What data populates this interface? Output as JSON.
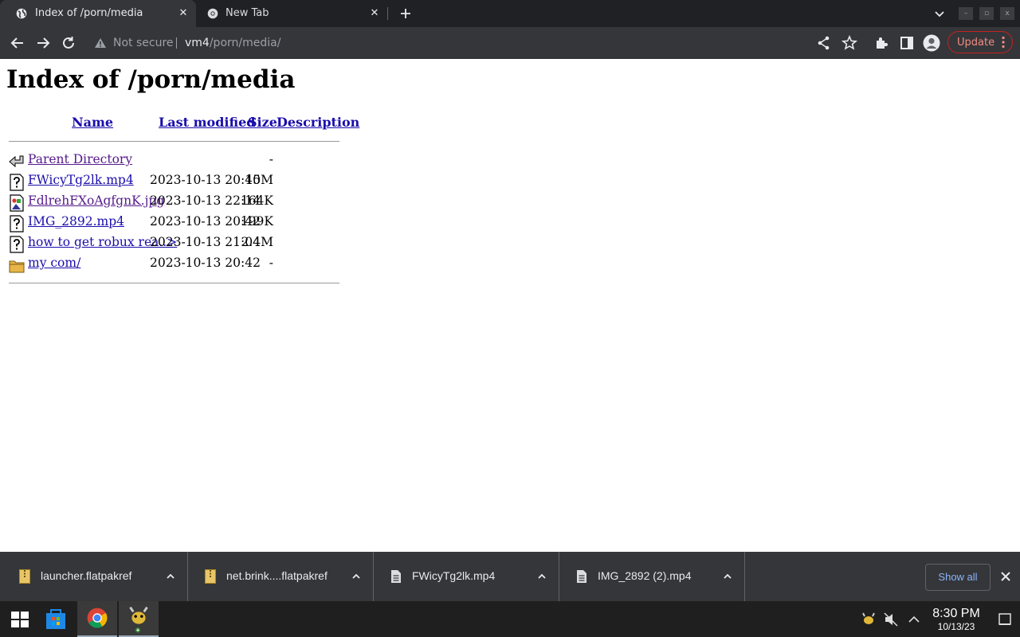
{
  "browser": {
    "tabs": [
      {
        "title": "Index of /porn/media",
        "active": true
      },
      {
        "title": "New Tab",
        "active": false
      }
    ],
    "omnibox": {
      "security_label": "Not secure",
      "host": "vm4",
      "path": "/porn/media/"
    },
    "update_label": "Update"
  },
  "page": {
    "heading": "Index of /porn/media",
    "columns": {
      "name": "Name",
      "last_modified": "Last modified",
      "size": "Size",
      "description": "Description"
    },
    "entries": [
      {
        "icon": "back-icon",
        "name": "Parent Directory",
        "modified": "",
        "size": "-",
        "visited": true
      },
      {
        "icon": "unknown-file-icon",
        "name": "FWicyTg2lk.mp4",
        "modified": "2023-10-13 20:40",
        "size": "15M",
        "visited": false
      },
      {
        "icon": "image-file-icon",
        "name": "FdlrehFXoAgfgnK.jpg",
        "modified": "2023-10-13 22:14",
        "size": "164K",
        "visited": true
      },
      {
        "icon": "unknown-file-icon",
        "name": "IMG_2892.mp4",
        "modified": "2023-10-13 20:42",
        "size": "199K",
        "visited": false
      },
      {
        "icon": "unknown-file-icon",
        "name": "how to get robux rea..>",
        "modified": "2023-10-13 21:04",
        "size": "2.4M",
        "visited": false
      },
      {
        "icon": "folder-icon",
        "name": "my com/",
        "modified": "2023-10-13 20:42",
        "size": "-",
        "visited": false
      }
    ]
  },
  "downloads": {
    "items": [
      {
        "name": "launcher.flatpakref",
        "icon": "archive-file-icon"
      },
      {
        "name": "net.brink....flatpakref",
        "icon": "archive-file-icon"
      },
      {
        "name": "FWicyTg2lk.mp4",
        "icon": "document-file-icon"
      },
      {
        "name": "IMG_2892 (2).mp4",
        "icon": "document-file-icon"
      }
    ],
    "show_all_label": "Show all"
  },
  "taskbar": {
    "time": "8:30 PM",
    "date": "10/13/23"
  },
  "colors": {
    "link": "#1a0dab",
    "visited": "#551a8b",
    "chrome_dark": "#202124",
    "toolbar": "#35363a",
    "update_accent": "#f28b82",
    "show_all_text": "#8ab4f8"
  }
}
